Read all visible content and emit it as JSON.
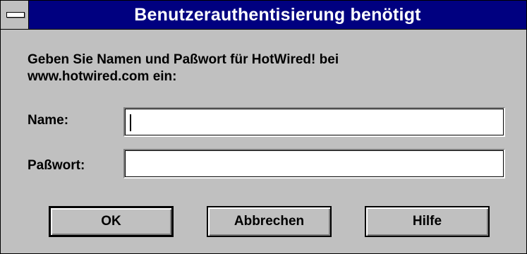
{
  "window": {
    "title": "Benutzerauthentisierung benötigt"
  },
  "dialog": {
    "prompt_line1": "Geben Sie Namen und Paßwort für HotWired! bei",
    "prompt_line2": "www.hotwired.com ein:",
    "name_label": "Name:",
    "name_value": "",
    "password_label": "Paßwort:",
    "password_value": ""
  },
  "buttons": {
    "ok": "OK",
    "cancel": "Abbrechen",
    "help": "Hilfe"
  },
  "colors": {
    "titlebar": "#000080",
    "face": "#c0c0c0"
  }
}
